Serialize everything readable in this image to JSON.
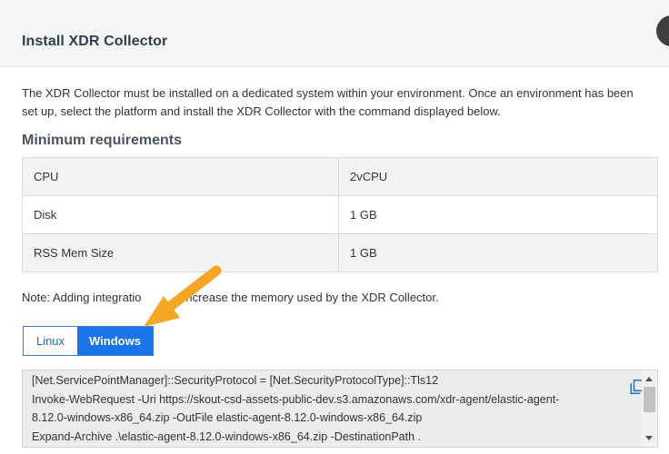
{
  "dialog": {
    "title": "Install XDR Collector"
  },
  "intro": {
    "line1": "The XDR Collector must be installed on a dedicated system within your environment. Once an environment has been",
    "line2": "set up, select the platform and install the XDR Collector with the command displayed below."
  },
  "requirements": {
    "heading": "Minimum requirements",
    "rows": [
      {
        "label": "CPU",
        "value": "2vCPU"
      },
      {
        "label": "Disk",
        "value": "1 GB"
      },
      {
        "label": "RSS Mem Size",
        "value": "1 GB"
      }
    ]
  },
  "note": {
    "before": "Note: Adding integratio",
    "after": "increase the memory used by the XDR Collector."
  },
  "platform": {
    "options": [
      "Linux",
      "Windows"
    ],
    "selected": "Windows"
  },
  "command": {
    "lines": [
      "[Net.ServicePointManager]::SecurityProtocol = [Net.SecurityProtocolType]::Tls12",
      "Invoke-WebRequest -Uri https://skout-csd-assets-public-dev.s3.amazonaws.com/xdr-agent/elastic-agent-",
      "8.12.0-windows-x86_64.zip -OutFile elastic-agent-8.12.0-windows-x86_64.zip",
      "Expand-Archive .\\elastic-agent-8.12.0-windows-x86_64.zip -DestinationPath ."
    ]
  },
  "icons": {
    "copy": "copy-icon",
    "annotation": "arrow-pointer-icon"
  },
  "colors": {
    "accent": "#1a73e8",
    "arrow": "#f5a623",
    "header_bg": "#f4f5f6"
  }
}
